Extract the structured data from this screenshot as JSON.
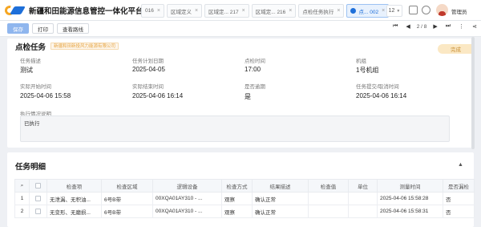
{
  "header": {
    "app_title": "新疆和田能源信息管控一体化平台",
    "tabs": [
      {
        "label": "016"
      },
      {
        "label": "区域定义"
      },
      {
        "label": "区域定... 217"
      },
      {
        "label": "区域定... 216"
      },
      {
        "label": "点检任务执行"
      },
      {
        "label": "点... 002"
      }
    ],
    "tab_count": "12",
    "user_name": "管理员"
  },
  "toolbar": {
    "save_label": "保存",
    "print_label": "打印",
    "route_label": "查看路线",
    "page_indicator": "2 / 8"
  },
  "inspection": {
    "title": "点检任务",
    "company": "新疆和田新投风力能源有限公司",
    "status": "完成",
    "fields": {
      "task_desc_label": "任务描述",
      "task_desc_value": "测试",
      "plan_date_label": "任务计划日期",
      "plan_date_value": "2025-04-05",
      "inspect_time_label": "点检时间",
      "inspect_time_value": "17:00",
      "unit_label": "机组",
      "unit_value": "1号机组",
      "actual_start_label": "实际开始时间",
      "actual_start_value": "2025-04-06 15:58",
      "actual_end_label": "实际结束时间",
      "actual_end_value": "2025-04-06 16:14",
      "overdue_label": "是否逾期",
      "overdue_value": "是",
      "submit_time_label": "任务提交/取消时间",
      "submit_time_value": "2025-04-06 16:14"
    },
    "notes_label": "执行情况说明",
    "notes_value": "已执行"
  },
  "details": {
    "title": "任务明细",
    "columns": [
      "",
      "",
      "检查项",
      "检查区域",
      "逻辑设备",
      "检查方式",
      "结果描述",
      "检查值",
      "单位",
      "测量时间",
      "是否漏检"
    ],
    "rows": [
      {
        "no": "1",
        "item": "无泄漏、无积油...",
        "area": "6号B带",
        "device": "00XQA01AY310 - ...",
        "method": "观察",
        "result": "确认正常",
        "value": "",
        "unit": "",
        "time": "2025-04-06 15:58:28",
        "missed": "否"
      },
      {
        "no": "2",
        "item": "无变形、无磨损...",
        "area": "6号B带",
        "device": "00XQA01AY310 - ...",
        "method": "观察",
        "result": "确认正常",
        "value": "",
        "unit": "",
        "time": "2025-04-06 15:58:31",
        "missed": "否"
      }
    ]
  }
}
